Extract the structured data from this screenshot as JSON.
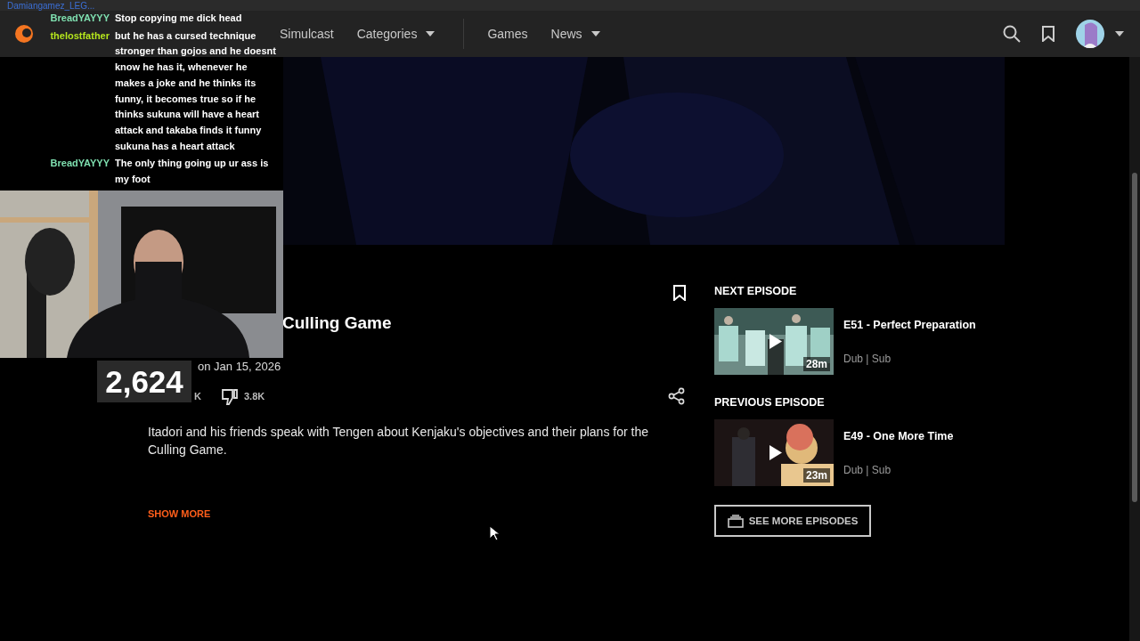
{
  "top_strip": {
    "username": "Damiangamez_LEG..."
  },
  "nav": {
    "items": [
      {
        "label": "Simulcast",
        "dropdown": false
      },
      {
        "label": "Categories",
        "dropdown": true
      },
      {
        "label": "Games",
        "dropdown": false
      },
      {
        "label": "News",
        "dropdown": true
      }
    ]
  },
  "chat": [
    {
      "user": "BreadYAYYY",
      "color": "#7fe0b0",
      "message": "Stop copying me dick head"
    },
    {
      "user": "thelostfather",
      "color": "#b5e61d",
      "message": "but he has a cursed technique stronger than gojos and he doesnt know he has it, whenever he makes a joke and he thinks its funny, it becomes true so if he thinks sukuna will have a heart attack and takaba finds it funny sukuna has a heart attack"
    },
    {
      "user": "BreadYAYYY",
      "color": "#7fe0b0",
      "message": "The only thing going up ur ass is my foot"
    }
  ],
  "viewer_count": "2,624",
  "episode": {
    "title": "Culling Game",
    "date": "on Jan 15, 2026",
    "likes": "K",
    "dislikes": "3.8K",
    "description": "Itadori and his friends speak with Tengen about Kenjaku's objectives and their plans for the Culling Game.",
    "show_more": "SHOW MORE"
  },
  "side": [
    {
      "heading": "NEXT EPISODE",
      "title": "E51 - Perfect Preparation",
      "duration": "28m",
      "languages": "Dub | Sub"
    },
    {
      "heading": "PREVIOUS EPISODE",
      "title": "E49 - One More Time",
      "duration": "23m",
      "languages": "Dub | Sub"
    }
  ],
  "see_more": "SEE MORE EPISODES"
}
